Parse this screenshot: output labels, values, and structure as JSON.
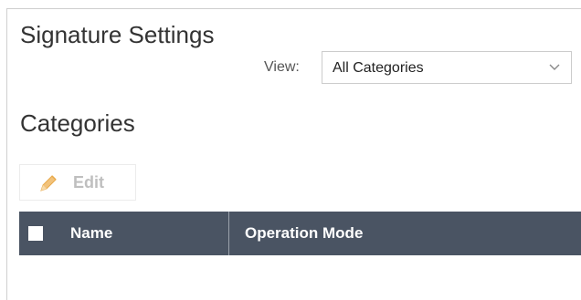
{
  "page": {
    "title": "Signature Settings"
  },
  "view_filter": {
    "label": "View:",
    "selected": "All Categories",
    "icon": "chevron-down-icon"
  },
  "categories": {
    "title": "Categories",
    "toolbar": {
      "edit_label": "Edit",
      "edit_icon": "pencil-icon",
      "edit_enabled": false
    },
    "table": {
      "columns": [
        "Name",
        "Operation Mode"
      ],
      "header_color": "#4a5463",
      "rows": []
    }
  }
}
